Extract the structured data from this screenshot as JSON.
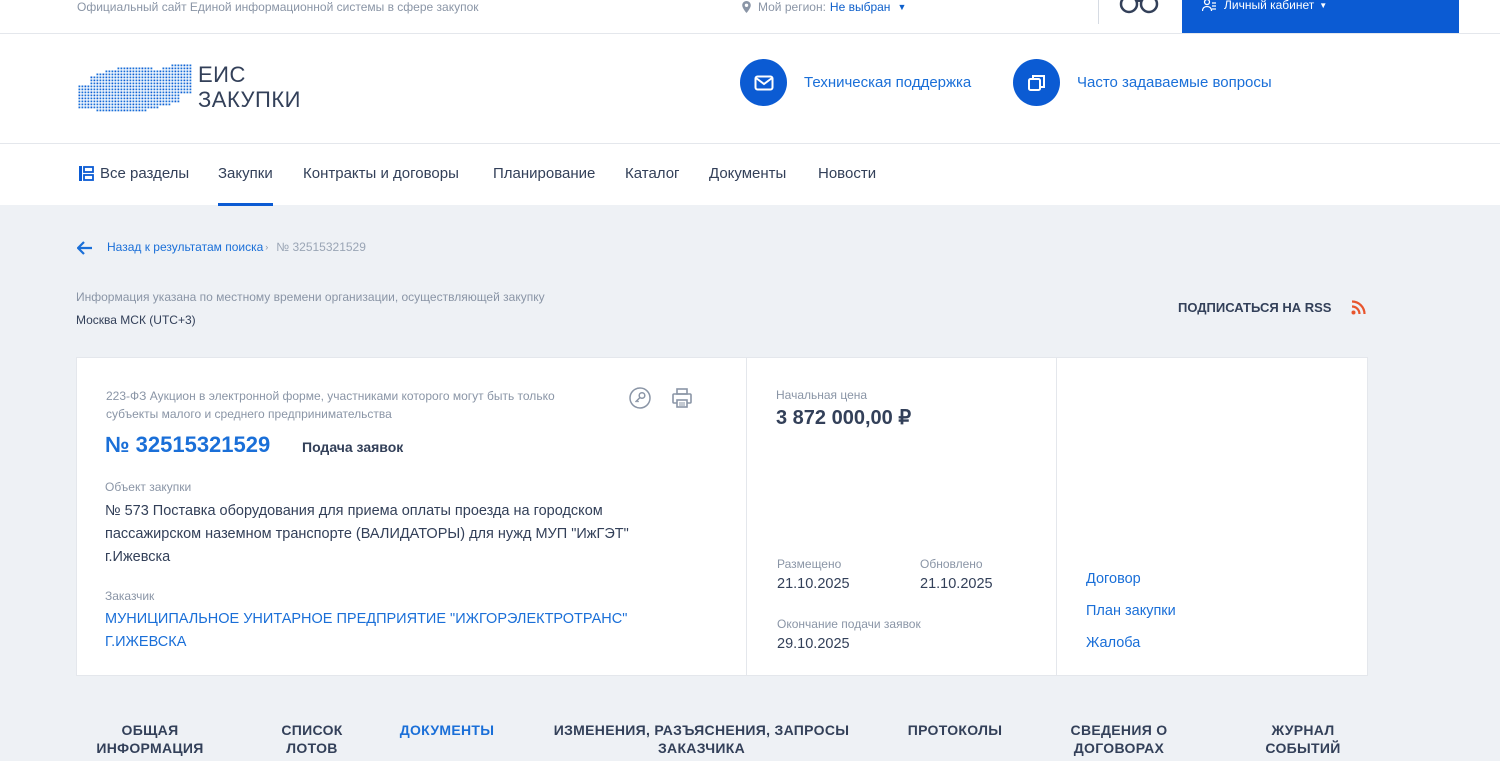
{
  "topbar": {
    "site_description": "Официальный сайт Единой информационной системы в сфере закупок",
    "region_label": "Мой регион:",
    "region_value": "Не выбран",
    "cabinet_label": "Личный кабинет"
  },
  "header": {
    "logo_line1": "ЕИС",
    "logo_line2": "ЗАКУПКИ",
    "support_label": "Техническая поддержка",
    "faq_label": "Часто задаваемые вопросы"
  },
  "nav": {
    "all_sections": "Все разделы",
    "items": [
      "Закупки",
      "Контракты и договоры",
      "Планирование",
      "Каталог",
      "Документы",
      "Новости"
    ],
    "active": "Закупки"
  },
  "breadcrumb": {
    "back": "Назад к результатам поиска",
    "current": "№ 32515321529"
  },
  "timezone": {
    "info": "Информация указана по местному времени организации, осуществляющей закупку",
    "value": "Москва МСК (UTC+3)"
  },
  "rss_label": "ПОДПИСАТЬСЯ НА RSS",
  "card": {
    "procurement_type": "223-ФЗ Аукцион в электронной форме, участниками которого могут быть только субъекты малого и среднего предпринимательства",
    "number": "№ 32515321529",
    "status": "Подача заявок",
    "object_label": "Объект закупки",
    "object_text": "№ 573 Поставка оборудования для приема оплаты проезда на городском пассажирском наземном транспорте (ВАЛИДАТОРЫ) для нужд МУП \"ИжГЭТ\" г.Ижевска",
    "customer_label": "Заказчик",
    "customer_name": "МУНИЦИПАЛЬНОЕ УНИТАРНОЕ ПРЕДПРИЯТИЕ \"ИЖГОРЭЛЕКТРОТРАНС\" Г.ИЖЕВСКА",
    "price_label": "Начальная цена",
    "price_value": "3 872 000,00 ₽",
    "posted_label": "Размещено",
    "posted_value": "21.10.2025",
    "updated_label": "Обновлено",
    "updated_value": "21.10.2025",
    "deadline_label": "Окончание подачи заявок",
    "deadline_value": "29.10.2025",
    "links": [
      "Договор",
      "План закупки",
      "Жалоба"
    ]
  },
  "tabs": [
    {
      "line1": "ОБЩАЯ",
      "line2": "ИНФОРМАЦИЯ"
    },
    {
      "line1": "СПИСОК",
      "line2": "ЛОТОВ"
    },
    {
      "line1": "ДОКУМЕНТЫ",
      "line2": ""
    },
    {
      "line1": "ИЗМЕНЕНИЯ, РАЗЪЯСНЕНИЯ, ЗАПРОСЫ",
      "line2": "ЗАКАЗЧИКА"
    },
    {
      "line1": "ПРОТОКОЛЫ",
      "line2": ""
    },
    {
      "line1": "СВЕДЕНИЯ О",
      "line2": "ДОГОВОРАХ"
    },
    {
      "line1": "ЖУРНАЛ",
      "line2": "СОБЫТИЙ"
    }
  ],
  "active_tab": "ДОКУМЕНТЫ",
  "colors": {
    "brand_blue": "#0b5bd3",
    "link_blue": "#1a6fd8",
    "text_dark": "#334059",
    "text_muted": "#8a95a6",
    "rss_orange": "#e8552d",
    "background": "#eef1f5"
  },
  "icons": {
    "region": "map-pin-icon",
    "accessibility": "glasses-icon",
    "cabinet": "user-icon",
    "support": "mail-icon",
    "faq": "windows-icon",
    "all_sections": "sections-icon",
    "back": "arrow-left-icon",
    "rss": "rss-icon",
    "key": "key-icon",
    "print": "printer-icon"
  }
}
